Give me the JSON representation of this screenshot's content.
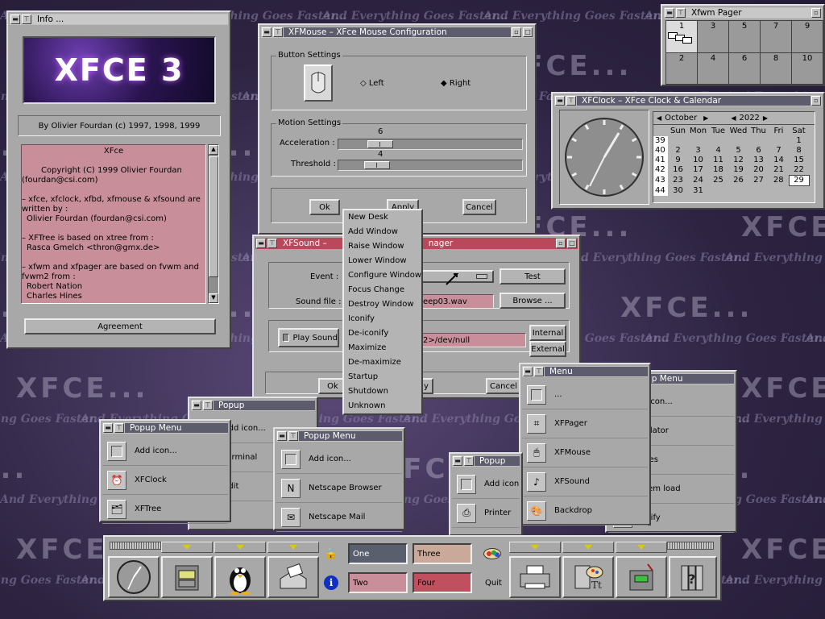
{
  "desktop": {
    "watermark_text": "And Everything Goes Faster...",
    "logo_text": "XFCE..."
  },
  "info_window": {
    "title": "Info ...",
    "logo": "XFCE 3",
    "author_line": "By Olivier Fourdan (c) 1997, 1998, 1999",
    "credits": [
      "XFce",
      "",
      "Copyright (C) 1999 Olivier Fourdan",
      "(fourdan@csi.com)",
      "",
      "– xfce, xfclock, xfbd, xfmouse & xfsound are",
      "written by :",
      "Olivier Fourdan (fourdan@csi.com)",
      "",
      "– XFTree is based on xtree from :",
      "Rasca Gmelch <thron@gmx.de>",
      "",
      "– xfwm and xfpager are based on fvwm and",
      "fvwm2 from :",
      "Robert Nation",
      "Charles Hines"
    ],
    "agreement_button": "Agreement"
  },
  "xfmouse": {
    "title": "XFMouse – XFce Mouse Configuration",
    "button_settings_label": "Button Settings",
    "left_label": "Left",
    "right_label": "Right",
    "motion_settings_label": "Motion Settings",
    "acceleration_label": "Acceleration :",
    "acceleration_value": "6",
    "threshold_label": "Threshold :",
    "threshold_value": "4",
    "ok": "Ok",
    "apply": "Apply",
    "cancel": "Cancel"
  },
  "xfsound": {
    "title_left": "XFSound –",
    "title_right": "nager",
    "event_label": "Event :",
    "test_button": "Test",
    "sound_file_label": "Sound file :",
    "sound_file_value": "eep03.wav",
    "browse_button": "Browse ...",
    "play_sound_label": "Play Sound",
    "command_value": "2>/dev/null",
    "internal_button": "Internal",
    "external_button": "External",
    "ok": "Ok",
    "apply_fragment": "y",
    "cancel": "Cancel"
  },
  "context_menu": {
    "items": [
      "New Desk",
      "Add Window",
      "Raise Window",
      "Lower Window",
      "Configure Window",
      "Focus Change",
      "Destroy Window",
      "Iconify",
      "De-iconify",
      "Maximize",
      "De-maximize",
      "Startup",
      "Shutdown",
      "Unknown"
    ]
  },
  "pager": {
    "title": "Xfwm Pager",
    "desks_top": [
      "1",
      "3",
      "5",
      "7",
      "9"
    ],
    "desks_bottom": [
      "2",
      "4",
      "6",
      "8",
      "10"
    ]
  },
  "xfclock": {
    "title": "XFClock – XFce Clock & Calendar",
    "month": "October",
    "year": "2022",
    "weekdays": [
      "Sun",
      "Mon",
      "Tue",
      "Wed",
      "Thu",
      "Fri",
      "Sat"
    ],
    "weeks": [
      {
        "wk": "39",
        "days": [
          "",
          "",
          "",
          "",
          "",
          "",
          "1"
        ]
      },
      {
        "wk": "40",
        "days": [
          "2",
          "3",
          "4",
          "5",
          "6",
          "7",
          "8"
        ]
      },
      {
        "wk": "41",
        "days": [
          "9",
          "10",
          "11",
          "12",
          "13",
          "14",
          "15"
        ]
      },
      {
        "wk": "42",
        "days": [
          "16",
          "17",
          "18",
          "19",
          "20",
          "21",
          "22"
        ]
      },
      {
        "wk": "43",
        "days": [
          "23",
          "24",
          "25",
          "26",
          "27",
          "28",
          "29"
        ]
      },
      {
        "wk": "44",
        "days": [
          "30",
          "31",
          "",
          "",
          "",
          "",
          ""
        ]
      }
    ],
    "today": "29"
  },
  "popup1": {
    "title": "Popup Menu",
    "items": [
      "Add icon...",
      "XFClock",
      "XFTree"
    ]
  },
  "popup2": {
    "title": "Popup",
    "items": [
      "Add icon...",
      "Terminal",
      "Edit"
    ]
  },
  "popup3": {
    "title": "Popup Menu",
    "items": [
      "Add icon...",
      "Netscape Browser",
      "Netscape Mail"
    ]
  },
  "popup4": {
    "title": "Popup",
    "items": [
      "Add icon",
      "Printer"
    ]
  },
  "popup5": {
    "title": "Menu",
    "items": [
      "...",
      "XFPager",
      "XFMouse",
      "XFSound",
      "Backdrop"
    ]
  },
  "popup6": {
    "title": "opup Menu",
    "items": [
      "d icon...",
      "culator",
      "itres",
      "stem load",
      "gnify"
    ]
  },
  "panel": {
    "desks": [
      "One",
      "Two",
      "Three",
      "Four"
    ],
    "quit_label": "Quit"
  },
  "colors": {
    "title_active": "#b8485a",
    "desk_one": "#5a5f6e",
    "desk_two": "#c88f9a",
    "desk_three": "#c9a99a",
    "desk_four": "#c0505e"
  }
}
